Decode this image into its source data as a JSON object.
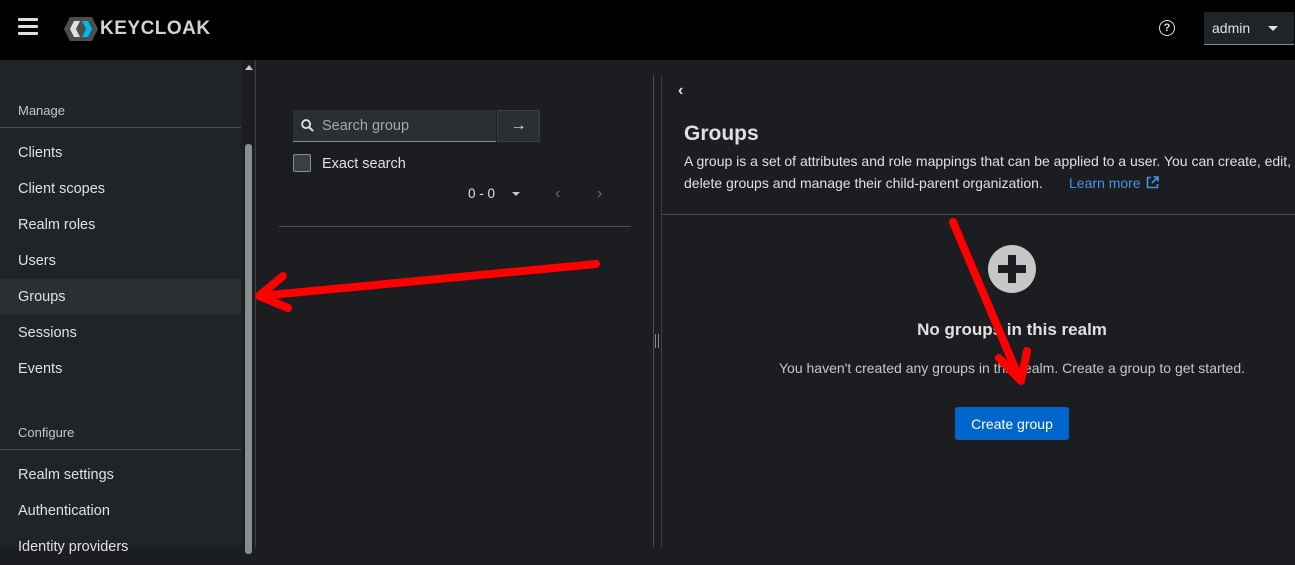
{
  "header": {
    "brand": "KEYCLOAK",
    "help_glyph": "?",
    "user": "admin"
  },
  "sidebar": {
    "sections": [
      {
        "title": "Manage",
        "items": [
          "Clients",
          "Client scopes",
          "Realm roles",
          "Users",
          "Groups",
          "Sessions",
          "Events"
        ]
      },
      {
        "title": "Configure",
        "items": [
          "Realm settings",
          "Authentication",
          "Identity providers"
        ]
      }
    ],
    "active": "Groups"
  },
  "tree": {
    "search_placeholder": "Search group",
    "search_go_glyph": "→",
    "exact_search": "Exact search",
    "pagination": "0 - 0",
    "prev_glyph": "‹",
    "next_glyph": "›"
  },
  "detail": {
    "collapse_glyph": "‹",
    "title": "Groups",
    "description_line1": "A group is a set of attributes and role mappings that can be applied to a user. You can create, edit, and",
    "description_line2": "delete groups and manage their child-parent organization.",
    "learn_more": "Learn more",
    "empty_title": "No groups in this realm",
    "empty_body": "You haven't created any groups in this realm. Create a group to get started.",
    "create_button": "Create group"
  },
  "icons": [
    "hamburger-icon",
    "keycloak-logo-icon",
    "help-icon",
    "caret-down-icon",
    "search-icon",
    "arrow-right-icon",
    "plus-circle-icon",
    "external-link-icon"
  ],
  "colors": {
    "accent": "#0066cc",
    "link": "#4394e5",
    "annotation": "#ff0000"
  }
}
